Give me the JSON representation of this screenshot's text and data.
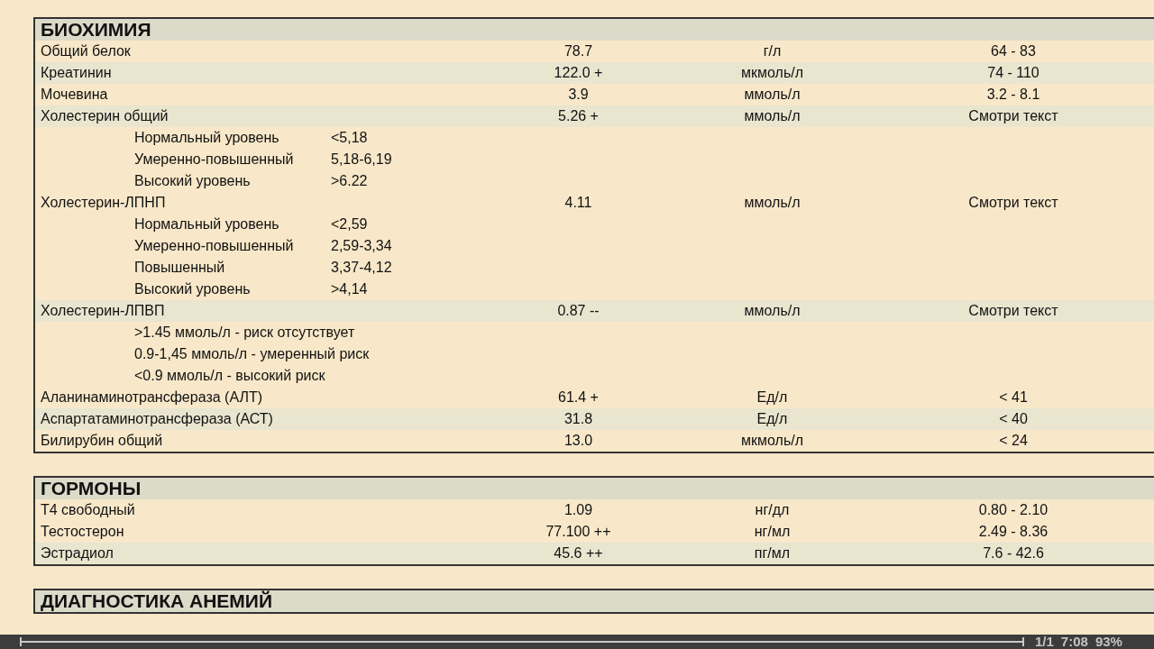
{
  "sections": [
    {
      "title": "БИОХИМИЯ",
      "rows": [
        {
          "kind": "result",
          "name": "Общий белок",
          "value": "78.7",
          "unit": "г/л",
          "reference": "64 - 83",
          "highlighted": false
        },
        {
          "kind": "result",
          "name": "Креатинин",
          "value": "122.0 +",
          "unit": "мкмоль/л",
          "reference": "74 - 110",
          "highlighted": true
        },
        {
          "kind": "result",
          "name": "Мочевина",
          "value": "3.9",
          "unit": "ммоль/л",
          "reference": "3.2 - 8.1",
          "highlighted": false
        },
        {
          "kind": "result",
          "name": "Холестерин общий",
          "value": "5.26 +",
          "unit": "ммоль/л",
          "reference": "Смотри текст",
          "highlighted": true
        },
        {
          "kind": "note",
          "label": "Нормальный уровень",
          "range": "<5,18"
        },
        {
          "kind": "note",
          "label": "Умеренно-повышенный",
          "range": "5,18-6,19"
        },
        {
          "kind": "note",
          "label": "Высокий уровень",
          "range": ">6.22"
        },
        {
          "kind": "result",
          "name": "Холестерин-ЛПНП",
          "value": "4.11",
          "unit": "ммоль/л",
          "reference": "Смотри текст",
          "highlighted": false
        },
        {
          "kind": "note",
          "label": "Нормальный уровень",
          "range": "<2,59"
        },
        {
          "kind": "note",
          "label": "Умеренно-повышенный",
          "range": "2,59-3,34"
        },
        {
          "kind": "note",
          "label": "Повышенный",
          "range": "3,37-4,12"
        },
        {
          "kind": "note",
          "label": "Высокий уровень",
          "range": ">4,14"
        },
        {
          "kind": "result",
          "name": "Холестерин-ЛПВП",
          "value": "0.87 --",
          "unit": "ммоль/л",
          "reference": "Смотри текст",
          "highlighted": true
        },
        {
          "kind": "note",
          "label": ">1.45 ммоль/л - риск отсутствует"
        },
        {
          "kind": "note",
          "label": "0.9-1,45 ммоль/л - умеренный риск"
        },
        {
          "kind": "note",
          "label": "<0.9 ммоль/л - высокий риск"
        },
        {
          "kind": "result",
          "name": "Аланинаминотрансфераза (АЛТ)",
          "value": "61.4 +",
          "unit": "Ед/л",
          "reference": "< 41",
          "highlighted": false
        },
        {
          "kind": "result",
          "name": "Аспартатаминотрансфераза (АСТ)",
          "value": "31.8",
          "unit": "Ед/л",
          "reference": "< 40",
          "highlighted": true
        },
        {
          "kind": "result",
          "name": "Билирубин общий",
          "value": "13.0",
          "unit": "мкмоль/л",
          "reference": "< 24",
          "highlighted": false
        }
      ]
    },
    {
      "title": "ГОРМОНЫ",
      "rows": [
        {
          "kind": "result",
          "name": "Т4 свободный",
          "value": "1.09",
          "unit": "нг/дл",
          "reference": "0.80 - 2.10",
          "highlighted": false
        },
        {
          "kind": "result",
          "name": "Тестостерон",
          "value": "77.100 ++",
          "unit": "нг/мл",
          "reference": "2.49 - 8.36",
          "highlighted": false
        },
        {
          "kind": "result",
          "name": "Эстрадиол",
          "value": "45.6 ++",
          "unit": "пг/мл",
          "reference": "7.6 - 42.6",
          "highlighted": true
        }
      ]
    },
    {
      "title": "ДИАГНОСТИКА АНЕМИЙ"
    }
  ],
  "status_bar": {
    "page": "1/1",
    "time": "7:08",
    "zoom": "93%"
  }
}
